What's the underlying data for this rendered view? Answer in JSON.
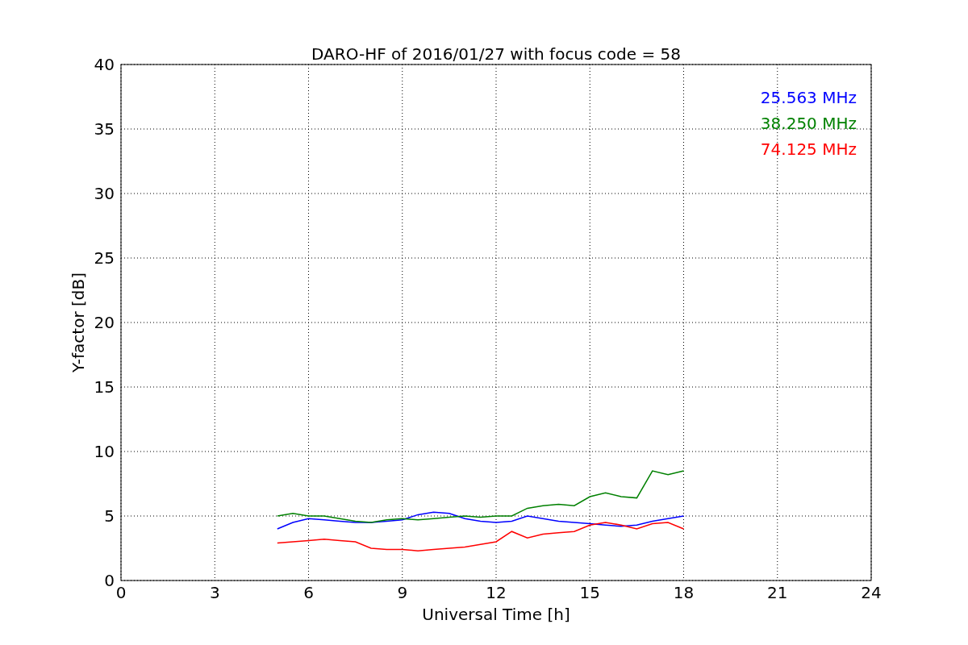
{
  "chart_data": {
    "type": "line",
    "title": "DARO-HF of 2016/01/27 with focus code = 58",
    "xlabel": "Universal Time [h]",
    "ylabel": "Y-factor [dB]",
    "x": [
      5,
      5.5,
      6,
      6.5,
      7,
      7.5,
      8,
      8.5,
      9,
      9.5,
      10,
      10.5,
      11,
      11.5,
      12,
      12.5,
      13,
      13.5,
      14,
      14.5,
      15,
      15.5,
      16,
      16.5,
      17,
      17.5,
      18
    ],
    "series": [
      {
        "name": "25.563 MHz",
        "color": "#0000ff",
        "values": [
          4.0,
          4.5,
          4.8,
          4.7,
          4.6,
          4.5,
          4.5,
          4.6,
          4.7,
          5.1,
          5.3,
          5.2,
          4.8,
          4.6,
          4.5,
          4.6,
          5.0,
          4.8,
          4.6,
          4.5,
          4.4,
          4.3,
          4.2,
          4.3,
          4.6,
          4.8,
          5.0
        ]
      },
      {
        "name": "38.250 MHz",
        "color": "#008000",
        "values": [
          5.0,
          5.2,
          5.0,
          5.0,
          4.8,
          4.6,
          4.5,
          4.7,
          4.8,
          4.7,
          4.8,
          4.9,
          5.0,
          4.9,
          5.0,
          5.0,
          5.6,
          5.8,
          5.9,
          5.8,
          6.5,
          6.8,
          6.5,
          6.4,
          8.5,
          8.2,
          8.5
        ]
      },
      {
        "name": "74.125 MHz",
        "color": "#ff0000",
        "values": [
          2.9,
          3.0,
          3.1,
          3.2,
          3.1,
          3.0,
          2.5,
          2.4,
          2.4,
          2.3,
          2.4,
          2.5,
          2.6,
          2.8,
          3.0,
          3.8,
          3.3,
          3.6,
          3.7,
          3.8,
          4.3,
          4.5,
          4.3,
          4.0,
          4.4,
          4.5,
          4.0
        ]
      }
    ],
    "xlim": [
      0,
      24
    ],
    "ylim": [
      0,
      40
    ],
    "xticks": [
      0,
      3,
      6,
      9,
      12,
      15,
      18,
      21,
      24
    ],
    "yticks": [
      0,
      5,
      10,
      15,
      20,
      25,
      30,
      35,
      40
    ],
    "grid": true
  }
}
